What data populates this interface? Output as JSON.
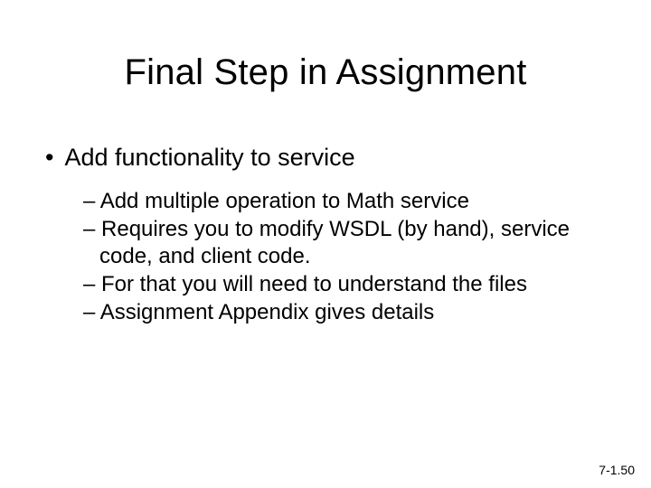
{
  "title": "Final Step in Assignment",
  "bullet": "Add functionality to service",
  "subs": [
    "Add multiple operation to Math service",
    "Requires you to modify WSDL (by hand), service code, and client code.",
    "For that you will need to understand the files",
    "Assignment Appendix gives details"
  ],
  "footer": "7-1.50"
}
